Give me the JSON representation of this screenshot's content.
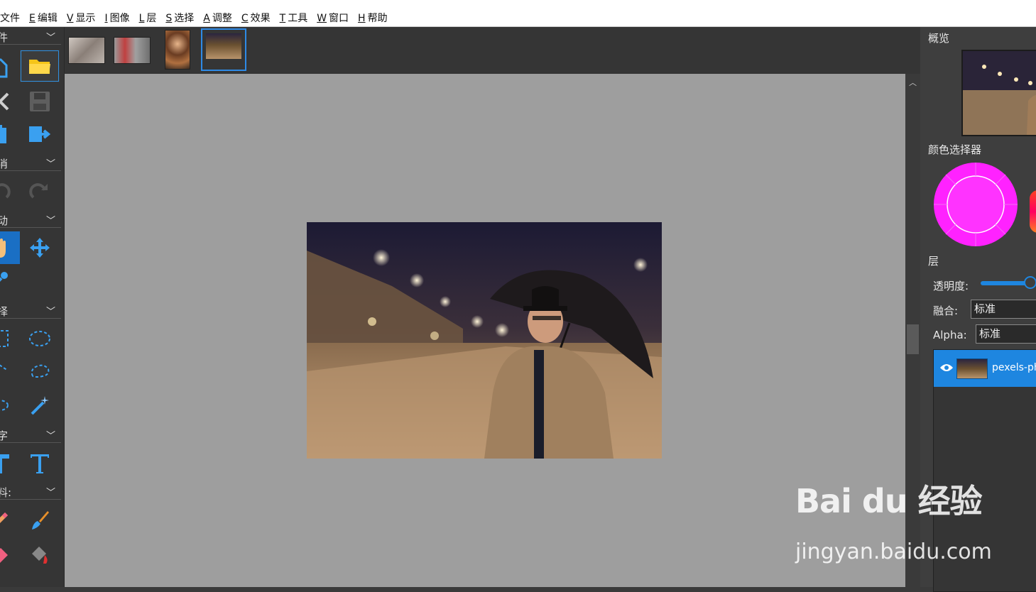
{
  "menubar": {
    "items": [
      {
        "key": "",
        "label": "文件"
      },
      {
        "key": "E",
        "label": "编辑"
      },
      {
        "key": "V",
        "label": "显示"
      },
      {
        "key": "I",
        "label": "图像"
      },
      {
        "key": "L",
        "label": "层"
      },
      {
        "key": "S",
        "label": "选择"
      },
      {
        "key": "A",
        "label": "调整"
      },
      {
        "key": "C",
        "label": "效果"
      },
      {
        "key": "T",
        "label": "工具"
      },
      {
        "key": "W",
        "label": "窗口"
      },
      {
        "key": "H",
        "label": "帮助"
      }
    ]
  },
  "toolbox": {
    "sections": [
      {
        "label": "件",
        "icons": [
          "new-file-icon",
          "open-folder-icon",
          "close-icon",
          "save-icon",
          "clipboard-icon",
          "export-icon"
        ]
      },
      {
        "label": "消",
        "icons": [
          "undo-icon",
          "redo-icon"
        ]
      },
      {
        "label": "动",
        "icons": [
          "hand-icon",
          "move-icon",
          "eyedropper-icon"
        ]
      },
      {
        "label": "择",
        "icons": [
          "rect-select-icon",
          "ellipse-select-icon",
          "polygon-select-icon",
          "lasso-icon",
          "free-select-icon",
          "magic-wand-icon"
        ]
      },
      {
        "label": "字",
        "icons": [
          "text-bold-icon",
          "text-icon"
        ]
      },
      {
        "label": "料:",
        "icons": [
          "pencil-icon",
          "brush-icon",
          "eraser-icon",
          "paint-bucket-icon"
        ]
      }
    ]
  },
  "right_panel": {
    "overview_title": "概览",
    "color_picker_title": "颜色选择器",
    "layers_title": "层",
    "opacity_label": "透明度:",
    "blend_label": "融合:",
    "blend_value": "标准",
    "alpha_label": "Alpha:",
    "alpha_value": "标准",
    "layer_name": "pexels-ph",
    "primary_color": "#ff22ff",
    "accent_color": "#1e86e0"
  },
  "watermark": {
    "logo": "Bai du 经验",
    "url": "jingyan.baidu.com"
  }
}
